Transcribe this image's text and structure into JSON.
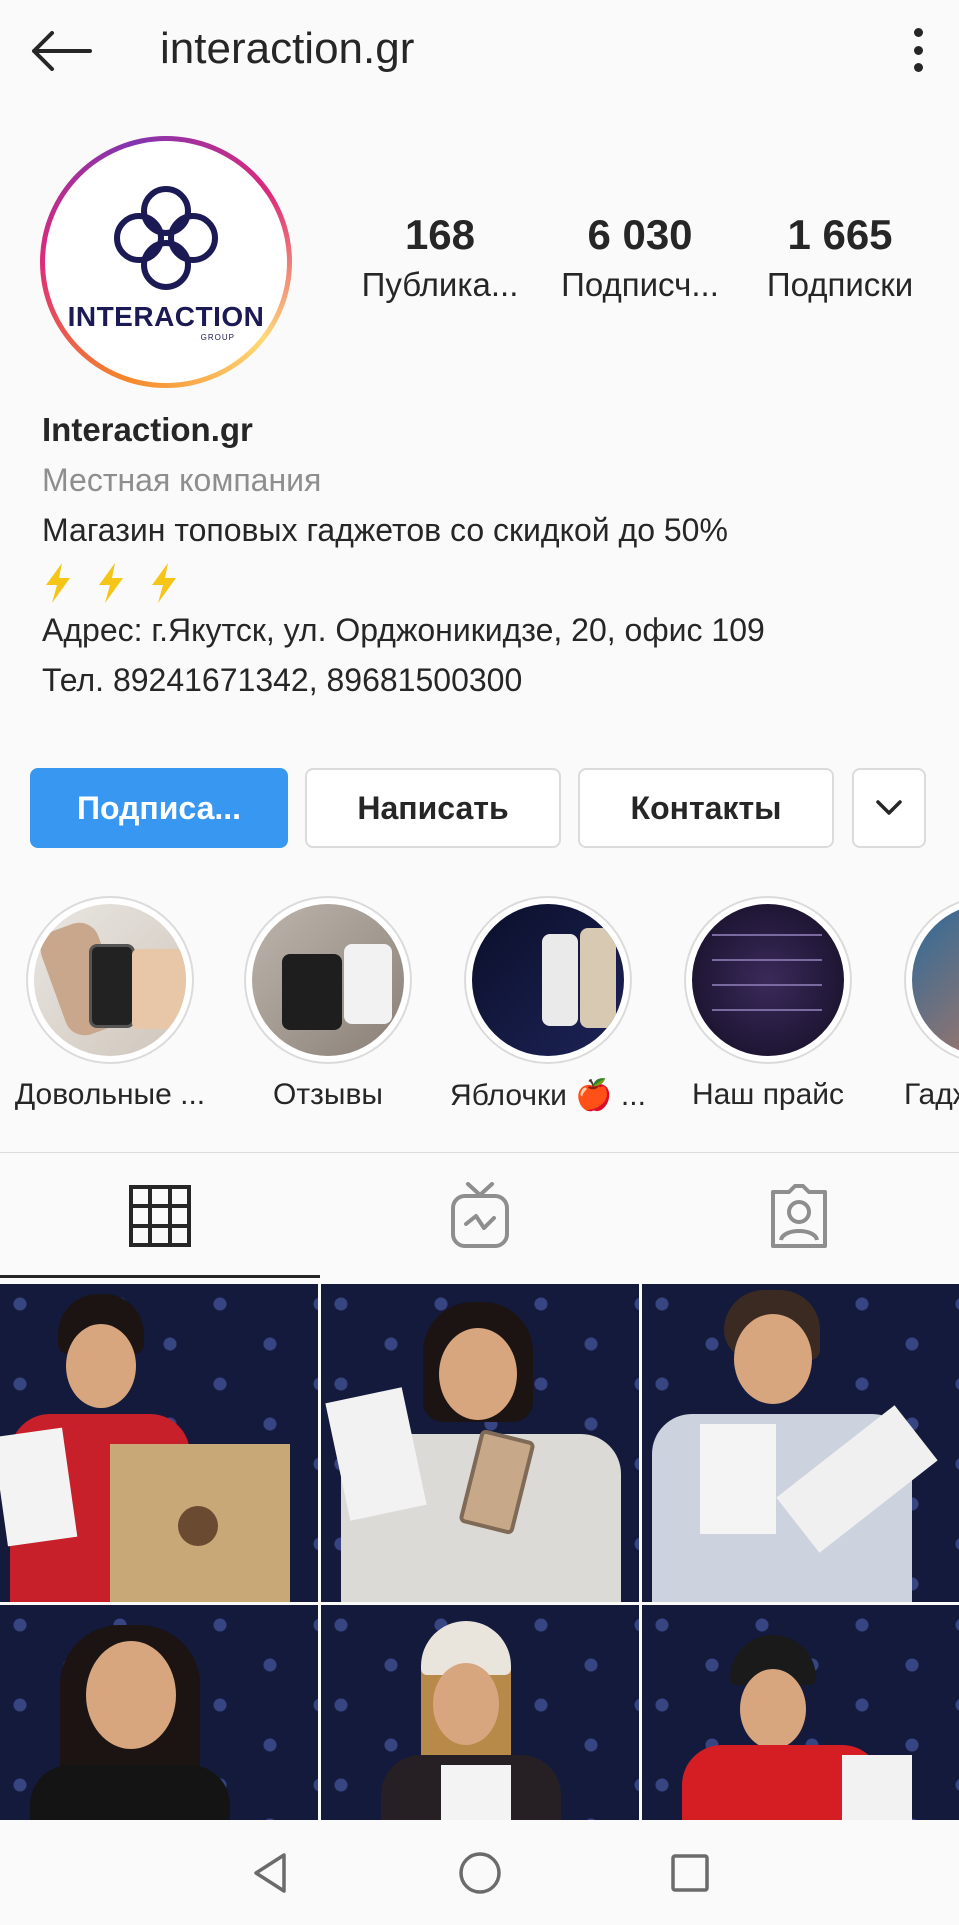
{
  "header": {
    "back_icon": "arrow-left-icon",
    "title": "interaction.gr",
    "more_icon": "vertical-dots-icon"
  },
  "profile": {
    "avatar_logo_text": "INTERACTION",
    "avatar_logo_sub": "GROUP",
    "stats": [
      {
        "value": "168",
        "label": "Публика..."
      },
      {
        "value": "6 030",
        "label": "Подписч..."
      },
      {
        "value": "1 665",
        "label": "Подписки"
      }
    ],
    "name": "Interaction.gr",
    "category": "Местная компания",
    "bio_line1": "Магазин топовых гаджетов со скидкой до 50%",
    "bio_emoji": "⚡⚡⚡",
    "bio_line2": "Адрес: г.Якутск, ул. Орджоникидзе, 20, офис 109",
    "bio_line3": "Тел. 89241671342, 89681500300"
  },
  "actions": {
    "follow_label": "Подписа...",
    "message_label": "Написать",
    "contacts_label": "Контакты",
    "more_icon": "chevron-down-icon"
  },
  "highlights": [
    {
      "label": "Довольные ..."
    },
    {
      "label": "Отзывы"
    },
    {
      "label": "Яблочки 🍎 ..."
    },
    {
      "label": "Наш прайс"
    },
    {
      "label": "Гадж"
    }
  ],
  "tabs": [
    {
      "icon": "grid-icon",
      "active": true
    },
    {
      "icon": "igtv-icon",
      "active": false
    },
    {
      "icon": "tagged-person-icon",
      "active": false
    }
  ],
  "navbar": {
    "back_icon": "triangle-back-icon",
    "home_icon": "circle-home-icon",
    "recents_icon": "square-recents-icon"
  },
  "colors": {
    "accent_blue": "#3897f0",
    "text": "#262626",
    "muted": "#8e8e8e",
    "border": "#dbdbdb",
    "logo_navy": "#1c1a54"
  }
}
